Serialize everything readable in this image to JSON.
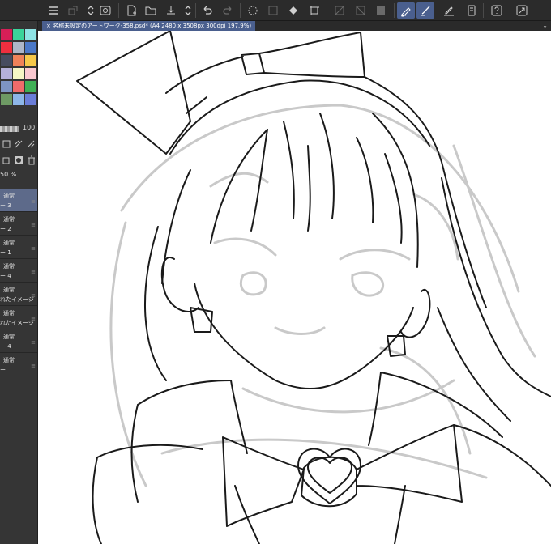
{
  "toolbar": {
    "items": [
      {
        "icon": "menu-icon",
        "state": "normal"
      },
      {
        "icon": "tool-settings-icon",
        "state": "dim"
      },
      {
        "icon": "navigator-icon",
        "state": "normal"
      },
      {
        "icon": "new-file-icon",
        "state": "normal"
      },
      {
        "icon": "open-folder-icon",
        "state": "normal"
      },
      {
        "icon": "save-icon",
        "state": "normal"
      },
      {
        "icon": "undo-icon",
        "state": "normal"
      },
      {
        "icon": "redo-icon",
        "state": "dim"
      },
      {
        "icon": "select-all-icon",
        "state": "normal"
      },
      {
        "icon": "clear-icon",
        "state": "dim"
      },
      {
        "icon": "fill-icon",
        "state": "normal"
      },
      {
        "icon": "transform-icon",
        "state": "normal"
      },
      {
        "icon": "snap-off-icon",
        "state": "dim"
      },
      {
        "icon": "ruler-snap-icon",
        "state": "dim"
      },
      {
        "icon": "grid-icon",
        "state": "dim"
      },
      {
        "icon": "pen-stabilizer-icon",
        "state": "active"
      },
      {
        "icon": "brush-icon",
        "state": "normal"
      },
      {
        "icon": "pencil-icon",
        "state": "normal"
      },
      {
        "icon": "phone-icon",
        "state": "normal"
      },
      {
        "icon": "help-icon",
        "state": "normal"
      },
      {
        "icon": "expand-icon",
        "state": "normal"
      }
    ]
  },
  "tab": {
    "title": "名称未設定のアートワーク-358.psd* (A4 2480 x 3508px 300dpi 197.9%)",
    "arrow": "⌄"
  },
  "left_panel": {
    "swatch_colors": [
      "#d61f57",
      "#3ad39a",
      "#8ee3e4",
      "#ef2f3f",
      "#aeb7c8",
      "#4b79c9",
      "#474c5f",
      "#f08259",
      "#f6c84a",
      "#b5b0d9",
      "#f6f6c5",
      "#fbc9d1",
      "#7e95c3",
      "#f06b6b",
      "#3fb055",
      "#6e9a64",
      "#8db6e8",
      "#6a7dd8"
    ],
    "opacity_value": "100",
    "opacity_percent": "50 %",
    "layers": [
      {
        "mode": "通常",
        "name": "ー 3",
        "selected": true
      },
      {
        "mode": "通常",
        "name": "ー 2",
        "selected": false
      },
      {
        "mode": "通常",
        "name": "ー 1",
        "selected": false
      },
      {
        "mode": "通常",
        "name": "ー 4",
        "selected": false
      },
      {
        "mode": "通常",
        "name": "れたイメージ",
        "selected": false
      },
      {
        "mode": "通常",
        "name": "れたイメージ",
        "selected": false
      },
      {
        "mode": "通常",
        "name": "ー 4",
        "selected": false
      },
      {
        "mode": "通常",
        "name": "ー",
        "selected": false
      }
    ],
    "layer_grip": "≡"
  },
  "canvas": {
    "background": "#ffffff",
    "line_color": "#1a1a1a",
    "sketch_color": "#c9c9c9"
  }
}
